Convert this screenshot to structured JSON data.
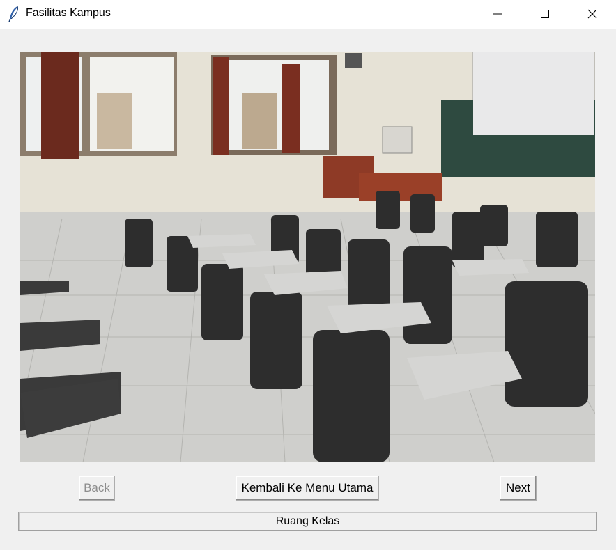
{
  "window": {
    "title": "Fasilitas Kampus",
    "icon": "feather-icon",
    "controls": [
      "minimize-icon",
      "maximize-icon",
      "close-icon"
    ]
  },
  "photo": {
    "subject": "classroom with folding tablet-arm chairs, windows and projection screen"
  },
  "buttons": {
    "back_label": "Back",
    "back_enabled": false,
    "menu_label": "Kembali Ke Menu Utama",
    "next_label": "Next"
  },
  "status": {
    "label": "Ruang Kelas"
  }
}
